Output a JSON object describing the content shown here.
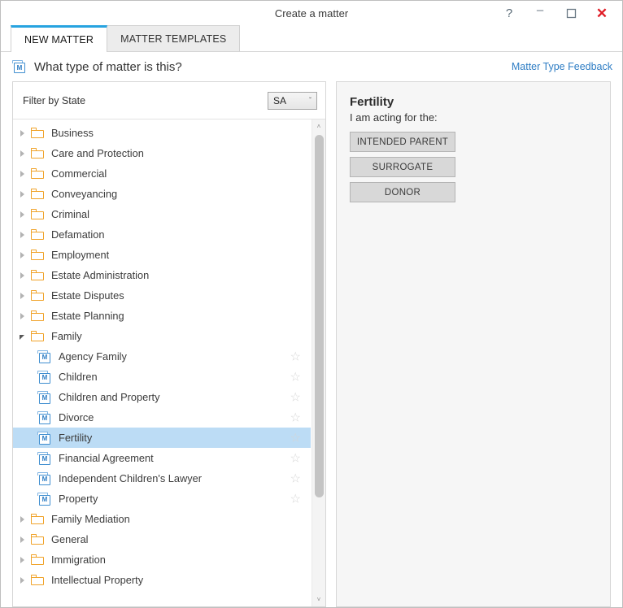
{
  "window": {
    "title": "Create a matter",
    "controls": [
      {
        "name": "help-button",
        "glyph": "?"
      },
      {
        "name": "minimize-button",
        "glyph": "–"
      },
      {
        "name": "maximize-button",
        "glyph": "□"
      },
      {
        "name": "close-button",
        "glyph": "✕",
        "color": "#e01b24"
      }
    ]
  },
  "tabs": [
    {
      "label": "NEW MATTER",
      "active": true
    },
    {
      "label": "MATTER TEMPLATES",
      "active": false
    }
  ],
  "header": {
    "icon": "matter-document-icon",
    "icon_letter": "M",
    "title": "What type of matter is this?",
    "feedback_link": "Matter Type Feedback"
  },
  "filter": {
    "label": "Filter by State",
    "state_value": "SA",
    "caret": "ˇ"
  },
  "tree": {
    "items": [
      {
        "label": "Business",
        "level": 0,
        "expanded": false,
        "selected": false
      },
      {
        "label": "Care and Protection",
        "level": 0,
        "expanded": false,
        "selected": false
      },
      {
        "label": "Commercial",
        "level": 0,
        "expanded": false,
        "selected": false
      },
      {
        "label": "Conveyancing",
        "level": 0,
        "expanded": false,
        "selected": false
      },
      {
        "label": "Criminal",
        "level": 0,
        "expanded": false,
        "selected": false
      },
      {
        "label": "Defamation",
        "level": 0,
        "expanded": false,
        "selected": false
      },
      {
        "label": "Employment",
        "level": 0,
        "expanded": false,
        "selected": false
      },
      {
        "label": "Estate Administration",
        "level": 0,
        "expanded": false,
        "selected": false
      },
      {
        "label": "Estate Disputes",
        "level": 0,
        "expanded": false,
        "selected": false
      },
      {
        "label": "Estate Planning",
        "level": 0,
        "expanded": false,
        "selected": false
      },
      {
        "label": "Family",
        "level": 0,
        "expanded": true,
        "selected": false
      },
      {
        "label": "Agency Family",
        "level": 1,
        "selected": false,
        "star": "☆"
      },
      {
        "label": "Children",
        "level": 1,
        "selected": false,
        "star": "☆"
      },
      {
        "label": "Children and Property",
        "level": 1,
        "selected": false,
        "star": "☆"
      },
      {
        "label": "Divorce",
        "level": 1,
        "selected": false,
        "star": "☆"
      },
      {
        "label": "Fertility",
        "level": 1,
        "selected": true,
        "star": "☆"
      },
      {
        "label": "Financial Agreement",
        "level": 1,
        "selected": false,
        "star": "☆"
      },
      {
        "label": "Independent Children's Lawyer",
        "level": 1,
        "selected": false,
        "star": "☆"
      },
      {
        "label": "Property",
        "level": 1,
        "selected": false,
        "star": "☆"
      },
      {
        "label": "Family Mediation",
        "level": 0,
        "expanded": false,
        "selected": false
      },
      {
        "label": "General",
        "level": 0,
        "expanded": false,
        "selected": false
      },
      {
        "label": "Immigration",
        "level": 0,
        "expanded": false,
        "selected": false
      },
      {
        "label": "Intellectual Property",
        "level": 0,
        "expanded": false,
        "selected": false
      }
    ]
  },
  "scrollbar": {
    "up_glyph": "˄",
    "down_glyph": "˅"
  },
  "detail": {
    "title": "Fertility",
    "subtitle": "I am acting for the:",
    "roles": [
      {
        "label": "INTENDED PARENT"
      },
      {
        "label": "SURROGATE"
      },
      {
        "label": "DONOR"
      }
    ]
  },
  "colors": {
    "accent": "#27a3e0",
    "link": "#2e7dc4",
    "selection": "#bcdcf5",
    "folder": "#f0a32a",
    "close": "#e01b24"
  }
}
